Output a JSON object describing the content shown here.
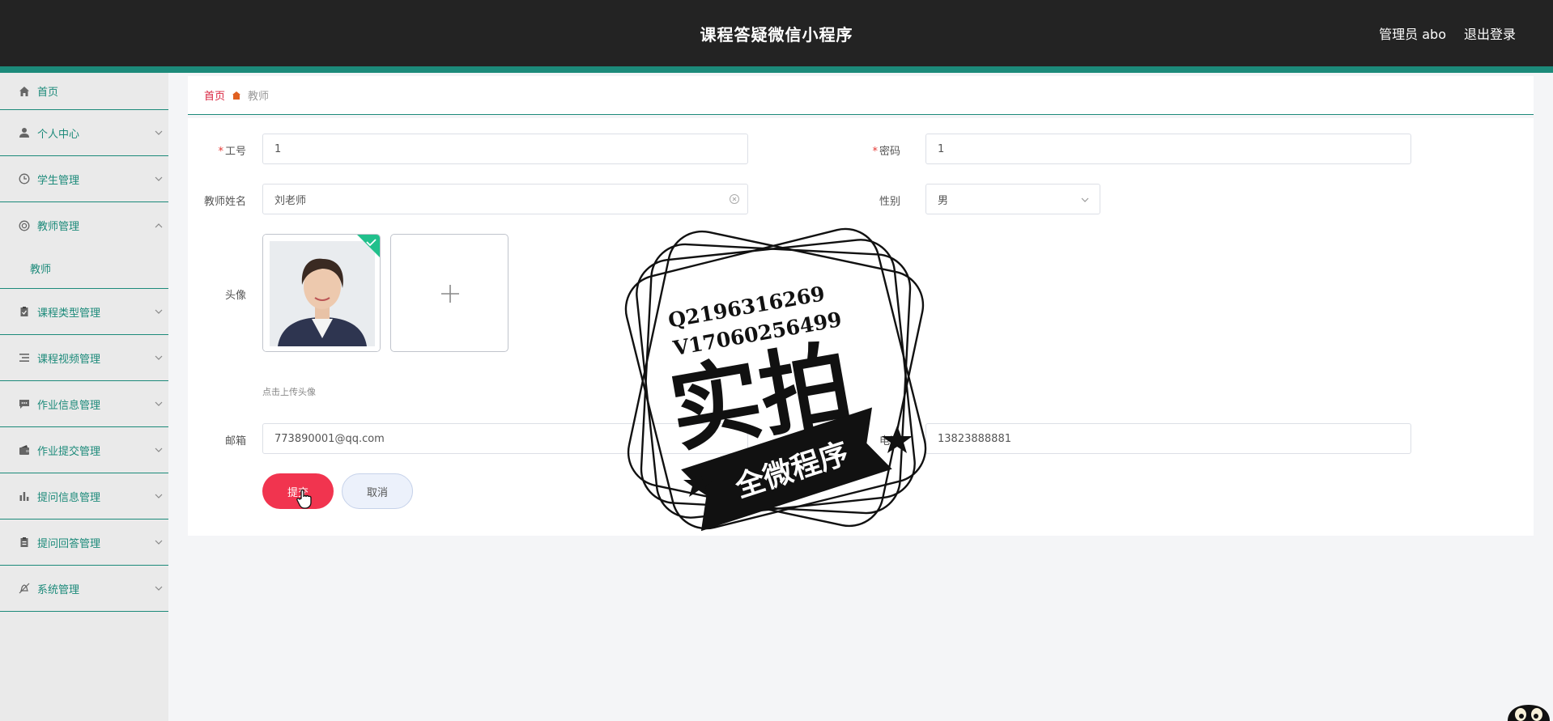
{
  "header": {
    "title": "课程答疑微信小程序",
    "user": "管理员 abo",
    "logout": "退出登录"
  },
  "sidebar": {
    "items": [
      {
        "label": "首页",
        "icon": "home-icon"
      },
      {
        "label": "个人中心",
        "icon": "user-icon"
      },
      {
        "label": "学生管理",
        "icon": "clock-icon"
      },
      {
        "label": "教师管理",
        "icon": "lifebuoy-icon"
      },
      {
        "label": "课程类型管理",
        "icon": "clipboard-icon"
      },
      {
        "label": "课程视频管理",
        "icon": "list-icon"
      },
      {
        "label": "作业信息管理",
        "icon": "message-icon"
      },
      {
        "label": "作业提交管理",
        "icon": "wallet-icon"
      },
      {
        "label": "提问信息管理",
        "icon": "bar-chart-icon"
      },
      {
        "label": "提问回答管理",
        "icon": "clipboard-icon"
      },
      {
        "label": "系统管理",
        "icon": "bell-off-icon"
      }
    ],
    "submenu_teacher": "教师"
  },
  "breadcrumb": {
    "home": "首页",
    "current": "教师"
  },
  "form": {
    "gonghao_label": "工号",
    "gonghao_value": "1",
    "mima_label": "密码",
    "mima_value": "1",
    "name_label": "教师姓名",
    "name_value": "刘老师",
    "gender_label": "性别",
    "gender_value": "男",
    "avatar_label": "头像",
    "upload_tip": "点击上传头像",
    "email_label": "邮箱",
    "email_value": "773890001@qq.com",
    "phone_label": "电话",
    "phone_value": "13823888881",
    "submit": "提交",
    "cancel": "取消"
  },
  "watermark": {
    "line1": "Q2196316269",
    "line2": "V17060256499",
    "big": "实拍",
    "ribbon": "全微程序"
  },
  "colors": {
    "accent": "#1c8a7a",
    "header_bg": "#232323",
    "submit": "#f1344f",
    "required": "#e53935"
  }
}
